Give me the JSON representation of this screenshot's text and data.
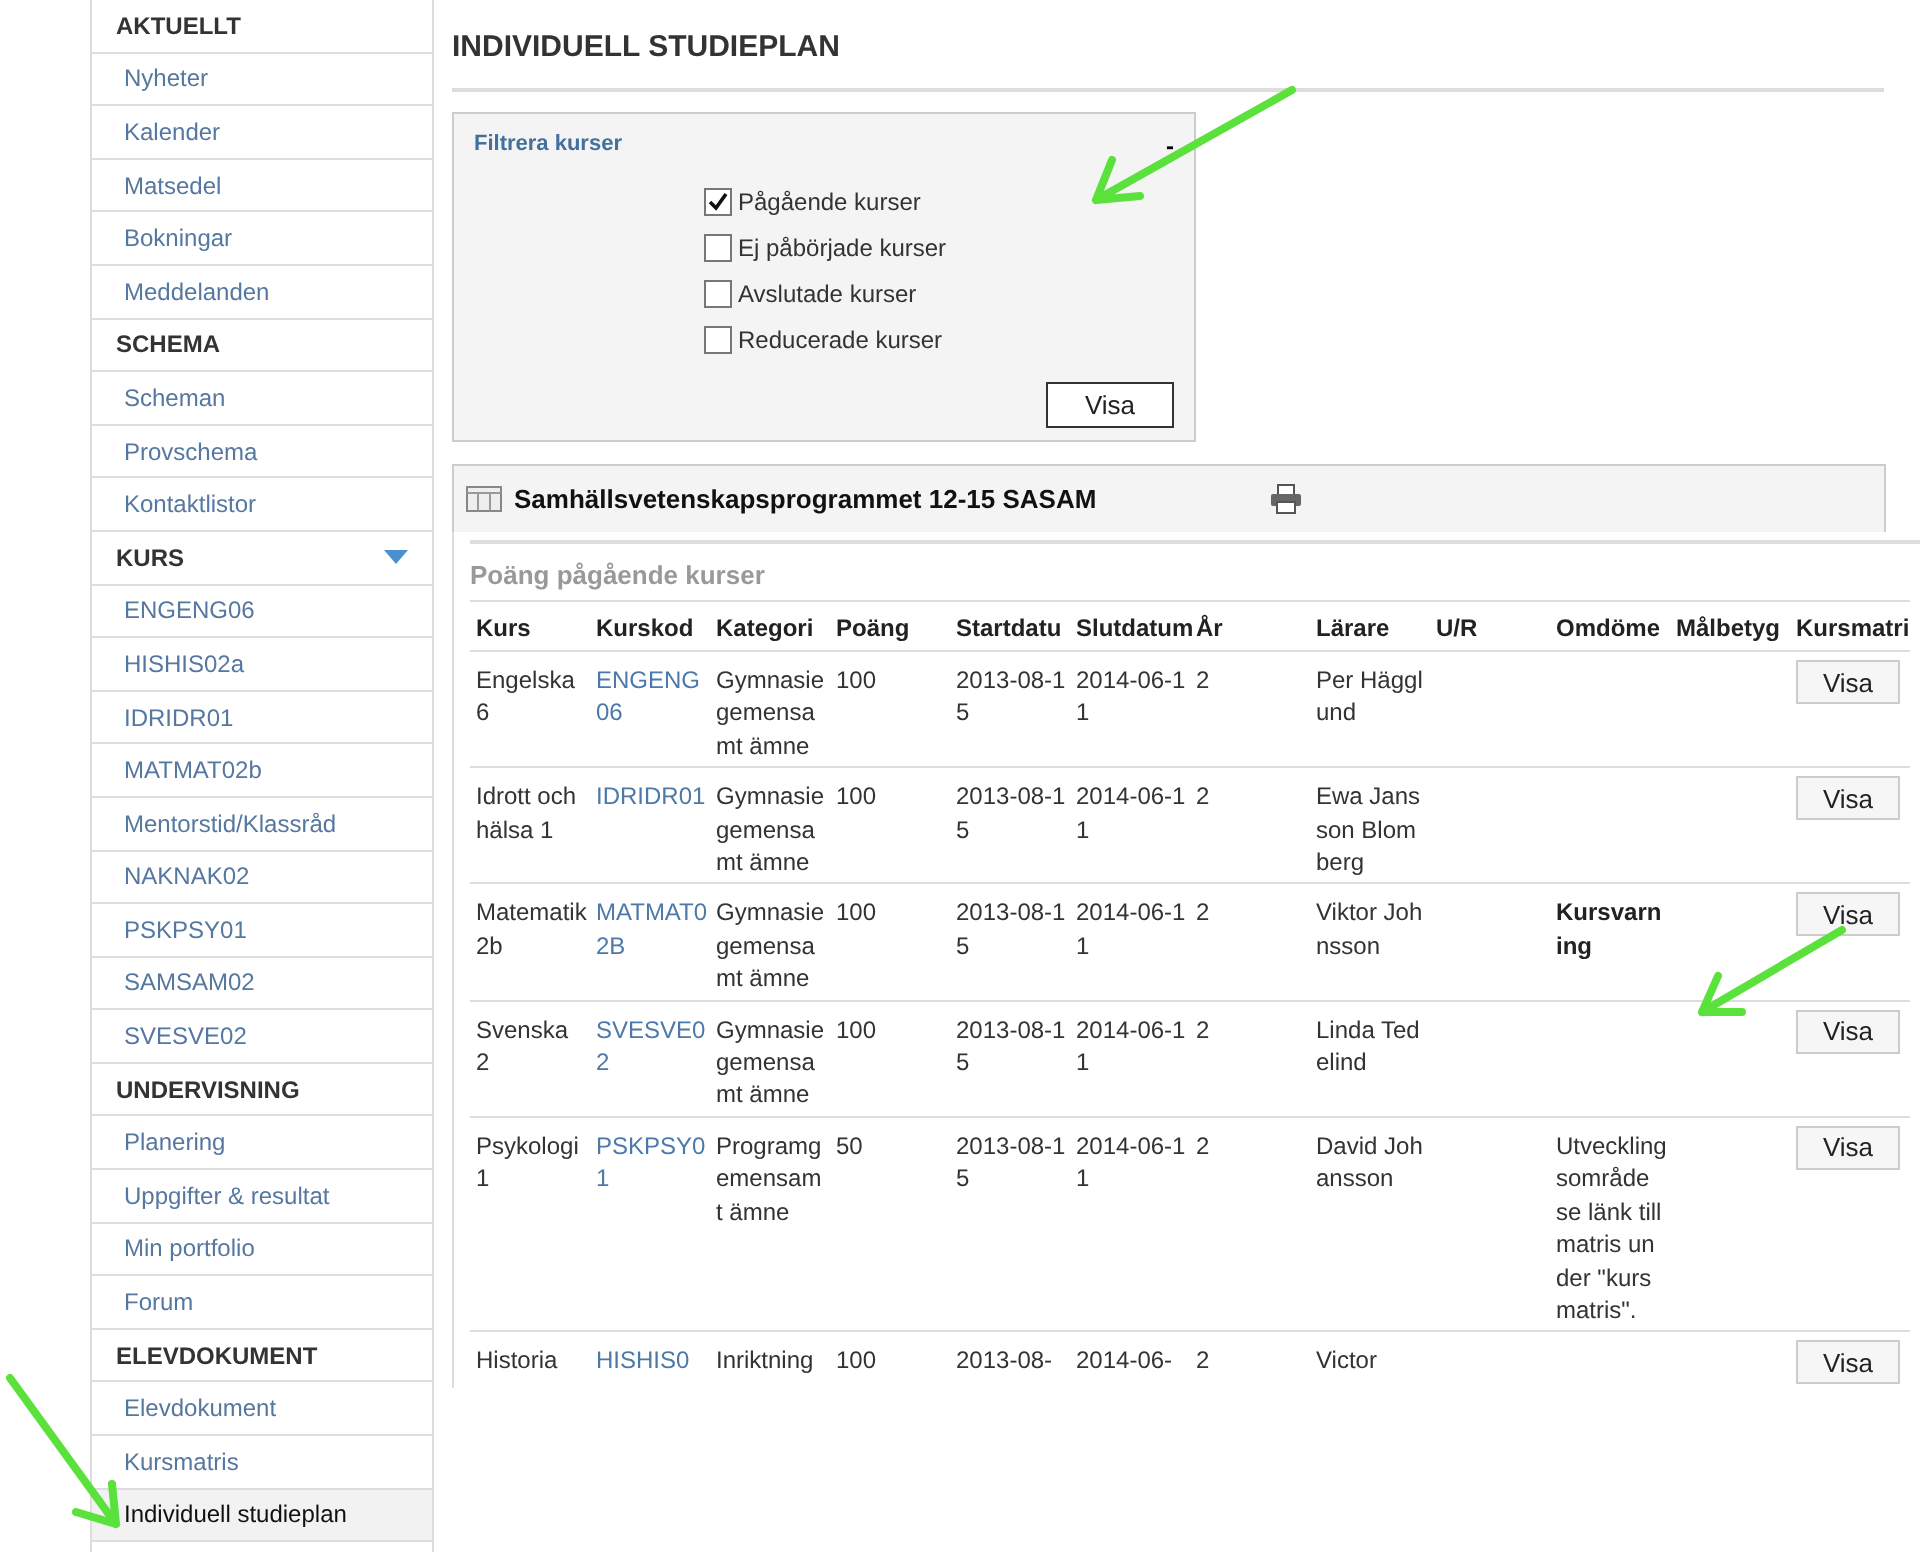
{
  "sidebar": {
    "sections": [
      {
        "title": "AKTUELLT",
        "expandable": false,
        "items": [
          {
            "label": "Nyheter",
            "selected": false
          },
          {
            "label": "Kalender",
            "selected": false
          },
          {
            "label": "Matsedel",
            "selected": false
          },
          {
            "label": "Bokningar",
            "selected": false
          },
          {
            "label": "Meddelanden",
            "selected": false
          }
        ]
      },
      {
        "title": "SCHEMA",
        "expandable": false,
        "items": [
          {
            "label": "Scheman",
            "selected": false
          },
          {
            "label": "Provschema",
            "selected": false
          },
          {
            "label": "Kontaktlistor",
            "selected": false
          }
        ]
      },
      {
        "title": "KURS",
        "expandable": true,
        "items": [
          {
            "label": "ENGENG06",
            "selected": false
          },
          {
            "label": "HISHIS02a",
            "selected": false
          },
          {
            "label": "IDRIDR01",
            "selected": false
          },
          {
            "label": "MATMAT02b",
            "selected": false
          },
          {
            "label": "Mentorstid/Klassråd",
            "selected": false
          },
          {
            "label": "NAKNAK02",
            "selected": false
          },
          {
            "label": "PSKPSY01",
            "selected": false
          },
          {
            "label": "SAMSAM02",
            "selected": false
          },
          {
            "label": "SVESVE02",
            "selected": false
          }
        ]
      },
      {
        "title": "UNDERVISNING",
        "expandable": false,
        "items": [
          {
            "label": "Planering",
            "selected": false
          },
          {
            "label": "Uppgifter & resultat",
            "selected": false
          },
          {
            "label": "Min portfolio",
            "selected": false
          },
          {
            "label": "Forum",
            "selected": false
          }
        ]
      },
      {
        "title": "ELEVDOKUMENT",
        "expandable": false,
        "items": [
          {
            "label": "Elevdokument",
            "selected": false
          },
          {
            "label": "Kursmatris",
            "selected": false
          },
          {
            "label": "Individuell studieplan",
            "selected": true
          }
        ]
      }
    ]
  },
  "page_title": "INDIVIDUELL STUDIEPLAN",
  "filter": {
    "title": "Filtrera kurser",
    "collapse": "-",
    "options": [
      {
        "label": "Pågående kurser",
        "checked": true
      },
      {
        "label": "Ej påbörjade kurser",
        "checked": false
      },
      {
        "label": "Avslutade kurser",
        "checked": false
      },
      {
        "label": "Reducerade kurser",
        "checked": false
      }
    ],
    "button": "Visa"
  },
  "program": {
    "title": "Samhällsvetenskapsprogrammet 12-15 SASAM"
  },
  "table": {
    "caption": "Poäng pågående kurser",
    "columns": [
      "Kurs",
      "Kurskod",
      "Kategori",
      "Poäng",
      "Startdatu",
      "Slutdatum",
      "År",
      "Lärare",
      "U/R",
      "Omdöme",
      "Målbetyg",
      "Kursmatri"
    ],
    "rows": [
      {
        "cells": [
          "Engelska 6",
          "ENGENG06",
          "Gymnasiegemensamt ämne",
          "100",
          "2013-08-15",
          "2014-06-11",
          "2",
          "Per Hägglund",
          ""
        ],
        "button": "Visa"
      },
      {
        "cells": [
          "Idrott och hälsa 1",
          "IDRIDR01",
          "Gymnasiegemensamt ämne",
          "100",
          "2013-08-15",
          "2014-06-11",
          "2",
          "Ewa Jansson Blomberg",
          ""
        ],
        "button": "Visa"
      },
      {
        "cells": [
          "Matematik 2b",
          "MATMAT02B",
          "Gymnasiegemensamt ämne",
          "100",
          "2013-08-15",
          "2014-06-11",
          "2",
          "Viktor Johnsson",
          ""
        ],
        "assessment": {
          "text": "Kursvarning",
          "bold": true
        },
        "button": "Visa"
      },
      {
        "cells": [
          "Svenska 2",
          "SVESVE02",
          "Gymnasiegemensamt ämne",
          "100",
          "2013-08-15",
          "2014-06-11",
          "2",
          "Linda Tedelind",
          ""
        ],
        "button": "Visa"
      },
      {
        "cells": [
          "Psykologi 1",
          "PSKPSY01",
          "Programgemensamt ämne",
          "50",
          "2013-08-15",
          "2014-06-11",
          "2",
          "David Johansson",
          ""
        ],
        "assessment": {
          "text": "Utvecklingsområde se länk till matris under \"kursmatris\".",
          "bold": false
        },
        "button": "Visa"
      },
      {
        "cells": [
          "Historia",
          "HISHIS0",
          "Inriktning",
          "100",
          "2013-08-",
          "2014-06-",
          "2",
          "Victor",
          ""
        ],
        "button": "Visa"
      }
    ]
  }
}
